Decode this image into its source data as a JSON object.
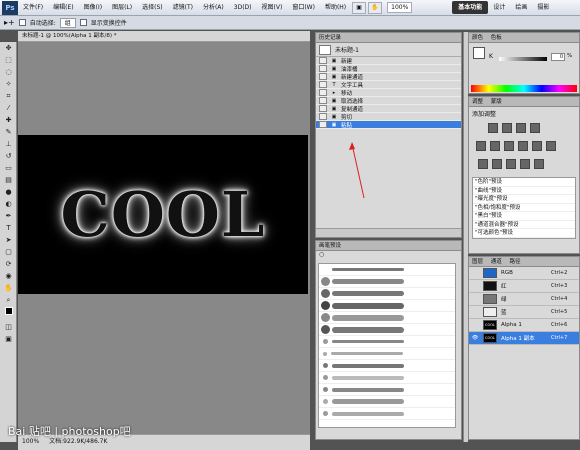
{
  "menubar": {
    "logo": "Ps",
    "menus": [
      "文件(F)",
      "编辑(E)",
      "图像(I)",
      "图层(L)",
      "选择(S)",
      "滤镜(T)",
      "分析(A)",
      "3D(D)",
      "视图(V)",
      "窗口(W)",
      "帮助(H)"
    ],
    "zoom": "100%",
    "workspace_active": "基本功能",
    "workspaces": [
      "设计",
      "绘画",
      "摄影"
    ]
  },
  "options": {
    "auto_select_label": "自动选择:",
    "auto_select_value": "组",
    "transform_label": "显示变换控件"
  },
  "document": {
    "tab_title": "未标题-1 @ 100%(Alpha 1 副本/8) *",
    "canvas_text": "COOL",
    "status_zoom": "100%",
    "status_doc": "文档:922.9K/486.7K"
  },
  "history": {
    "title": "历史记录",
    "snapshot": "未标题-1",
    "items": [
      {
        "icon": "▣",
        "label": "新建",
        "selected": false
      },
      {
        "icon": "▣",
        "label": "油漆桶",
        "selected": false
      },
      {
        "icon": "▣",
        "label": "新建通道",
        "selected": false
      },
      {
        "icon": "T",
        "label": "文字工具",
        "selected": false
      },
      {
        "icon": "▸",
        "label": "移动",
        "selected": false
      },
      {
        "icon": "▣",
        "label": "取消选择",
        "selected": false
      },
      {
        "icon": "▣",
        "label": "复制通道",
        "selected": false
      },
      {
        "icon": "▣",
        "label": "剪切",
        "selected": false
      },
      {
        "icon": "▣",
        "label": "粘贴",
        "selected": true
      }
    ]
  },
  "brushes": {
    "title": "画笔预设"
  },
  "color": {
    "title": "颜色",
    "tab2": "色板",
    "k_label": "K",
    "k_value": "0",
    "k_unit": "%"
  },
  "adjustments": {
    "title": "调整",
    "tab2": "蒙版",
    "subtitle": "添加调整",
    "presets": [
      "\"色阶\"预设",
      "\"曲线\"预设",
      "\"曝光度\"预设",
      "\"色相/饱和度\"预设",
      "\"黑白\"预设",
      "\"通道混合器\"预设",
      "\"可选颜色\"预设"
    ]
  },
  "channels": {
    "tabs": [
      "图层",
      "通道",
      "路径"
    ],
    "rows": [
      {
        "name": "RGB",
        "shortcut": "Ctrl+2",
        "thumb_color": "#1f66c9",
        "thumb_text": "",
        "selected": false,
        "visible": false
      },
      {
        "name": "红",
        "shortcut": "Ctrl+3",
        "thumb_color": "#111111",
        "thumb_text": "",
        "selected": false,
        "visible": false
      },
      {
        "name": "绿",
        "shortcut": "Ctrl+4",
        "thumb_color": "#777777",
        "thumb_text": "",
        "selected": false,
        "visible": false
      },
      {
        "name": "蓝",
        "shortcut": "Ctrl+5",
        "thumb_color": "#eeeeee",
        "thumb_text": "",
        "selected": false,
        "visible": false
      },
      {
        "name": "Alpha 1",
        "shortcut": "Ctrl+6",
        "thumb_color": "#000000",
        "thumb_text": "COOL",
        "selected": false,
        "visible": false
      },
      {
        "name": "Alpha 1 副本",
        "shortcut": "Ctrl+7",
        "thumb_color": "#000000",
        "thumb_text": "COOL",
        "selected": true,
        "visible": true
      }
    ]
  },
  "watermark": "Bai 贴吧 | photoshop吧"
}
